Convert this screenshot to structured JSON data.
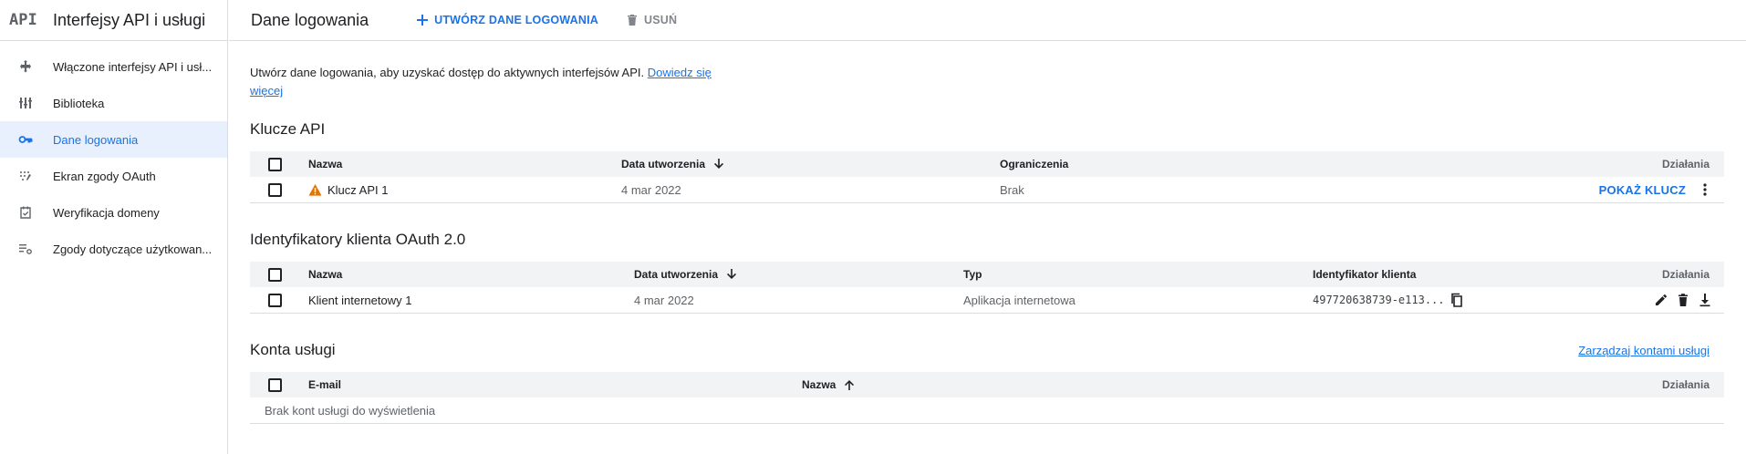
{
  "app": {
    "logo_text": "API",
    "title": "Interfejsy API i usługi"
  },
  "sidebar": {
    "items": [
      {
        "label": "Włączone interfejsy API i usł...",
        "icon": "move-icon",
        "active": false
      },
      {
        "label": "Biblioteka",
        "icon": "library-icon",
        "active": false
      },
      {
        "label": "Dane logowania",
        "icon": "key-icon",
        "active": true
      },
      {
        "label": "Ekran zgody OAuth",
        "icon": "oauth-dots-icon",
        "active": false
      },
      {
        "label": "Weryfikacja domeny",
        "icon": "calendar-check-icon",
        "active": false
      },
      {
        "label": "Zgody dotyczące użytkowan...",
        "icon": "list-settings-icon",
        "active": false
      }
    ]
  },
  "header": {
    "title": "Dane logowania",
    "create_label": "UTWÓRZ DANE LOGOWANIA",
    "delete_label": "USUŃ"
  },
  "intro": {
    "text": "Utwórz dane logowania, aby uzyskać dostęp do aktywnych interfejsów API.",
    "link": "Dowiedz się więcej"
  },
  "api_keys": {
    "title": "Klucze API",
    "columns": {
      "name": "Nazwa",
      "created": "Data utworzenia",
      "restrictions": "Ograniczenia",
      "actions": "Działania"
    },
    "rows": [
      {
        "name": "Klucz API 1",
        "created": "4 mar 2022",
        "restrictions": "Brak",
        "show_key": "POKAŻ KLUCZ"
      }
    ]
  },
  "oauth": {
    "title": "Identyfikatory klienta OAuth 2.0",
    "columns": {
      "name": "Nazwa",
      "created": "Data utworzenia",
      "type": "Typ",
      "client_id": "Identyfikator klienta",
      "actions": "Działania"
    },
    "rows": [
      {
        "name": "Klient internetowy 1",
        "created": "4 mar 2022",
        "type": "Aplikacja internetowa",
        "client_id": "497720638739-e113..."
      }
    ]
  },
  "service_accounts": {
    "title": "Konta usługi",
    "manage_link": "Zarządzaj kontami usługi",
    "columns": {
      "email": "E-mail",
      "name": "Nazwa",
      "actions": "Działania"
    },
    "empty_text": "Brak kont usługi do wyświetlenia"
  },
  "colors": {
    "accent": "#1a73e8",
    "active_bg": "#e8f0fe",
    "warning": "#e37400",
    "table_header_bg": "#f1f3f4"
  }
}
